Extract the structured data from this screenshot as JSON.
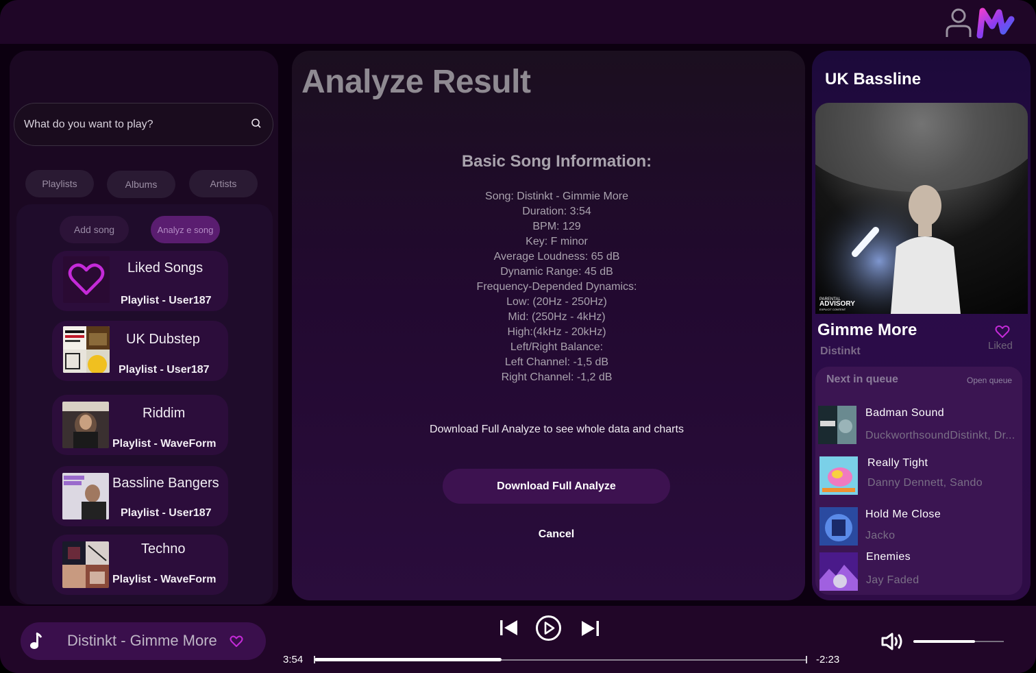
{
  "search": {
    "placeholder": "What do you want to play?"
  },
  "library": {
    "tabs": [
      "Playlists",
      "Albums",
      "Artists"
    ],
    "actions": {
      "add": "Add song",
      "analyze": "Analyz e song"
    },
    "playlists": [
      {
        "title": "Liked Songs",
        "subtitle": "Playlist - User187"
      },
      {
        "title": "UK Dubstep",
        "subtitle": "Playlist - User187"
      },
      {
        "title": "Riddim",
        "subtitle": "Playlist - WaveForm"
      },
      {
        "title": "Bassline Bangers",
        "subtitle": "Playlist - User187"
      },
      {
        "title": "Techno",
        "subtitle": "Playlist - WaveForm"
      }
    ]
  },
  "analyze": {
    "title": "Analyze Result",
    "heading": "Basic Song Information:",
    "lines": [
      "Song: Distinkt - Gimmie More",
      "Duration: 3:54",
      "BPM: 129",
      "Key: F minor",
      "Average Loudness: 65 dB",
      "Dynamic Range: 45 dB",
      "Frequency-Depended Dynamics:",
      "Low: (20Hz - 250Hz)",
      "Mid: (250Hz - 4kHz)",
      "High:(4kHz - 20kHz)",
      "Left/Right Balance:",
      "Left Channel: -1,5 dB",
      "Right Channel: -1,2 dB"
    ],
    "note": "Download Full Analyze to see whole data and charts",
    "download_label": "Download Full Analyze",
    "cancel_label": "Cancel"
  },
  "now_playing_panel": {
    "title": "UK Bassline",
    "cover_badge_line1": "PARENTAL",
    "cover_badge_line2": "ADVISORY",
    "cover_badge_line3": "EXPLICIT CONTENT",
    "song": "Gimme More",
    "artist": "Distinkt",
    "liked_label": "Liked",
    "queue_heading": "Next in queue",
    "open_queue_label": "Open queue",
    "queue": [
      {
        "title": "Badman Sound",
        "artist": "DuckworthsoundDistinkt, Dr..."
      },
      {
        "title": "Really Tight",
        "artist": "Danny Dennett, Sando"
      },
      {
        "title": "Hold Me Close",
        "artist": "Jacko"
      },
      {
        "title": "Enemies",
        "artist": "Jay Faded"
      }
    ]
  },
  "player": {
    "now_playing": "Distinkt - Gimme More",
    "elapsed": "3:54",
    "remaining": "-2:23",
    "progress": 0.38,
    "volume": 0.68
  },
  "colors": {
    "accent": "#b31fd6",
    "heart": "#c42ad8",
    "panel": "#1b0822",
    "button": "#3d1250"
  }
}
